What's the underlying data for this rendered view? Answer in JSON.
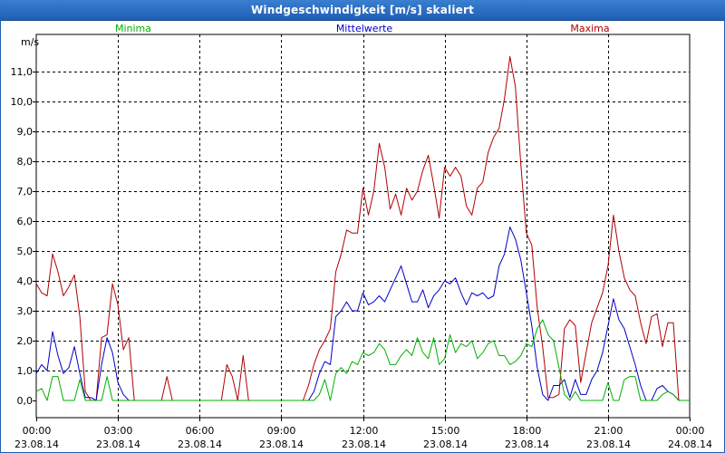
{
  "window": {
    "title": "Windgeschwindigkeit [m/s] skaliert"
  },
  "chart_data": {
    "type": "line",
    "title": "Windgeschwindigkeit [m/s] skaliert",
    "ylabel": "m/s",
    "xlabel": "",
    "ylim": [
      0,
      12
    ],
    "xlim_hours": [
      0,
      24
    ],
    "grid": true,
    "legend_placement": "top",
    "y_ticks": [
      "0,0",
      "1,0",
      "2,0",
      "3,0",
      "4,0",
      "5,0",
      "6,0",
      "7,0",
      "8,0",
      "9,0",
      "10,0",
      "11,0"
    ],
    "x_ticks": [
      {
        "hour": 0,
        "time": "00:00",
        "date": "23.08.14"
      },
      {
        "hour": 3,
        "time": "03:00",
        "date": "23.08.14"
      },
      {
        "hour": 6,
        "time": "06:00",
        "date": "23.08.14"
      },
      {
        "hour": 9,
        "time": "09:00",
        "date": "23.08.14"
      },
      {
        "hour": 12,
        "time": "12:00",
        "date": "23.08.14"
      },
      {
        "hour": 15,
        "time": "15:00",
        "date": "23.08.14"
      },
      {
        "hour": 18,
        "time": "18:00",
        "date": "23.08.14"
      },
      {
        "hour": 21,
        "time": "21:00",
        "date": "23.08.14"
      },
      {
        "hour": 24,
        "time": "00:00",
        "date": "24.08.14"
      }
    ],
    "series": [
      {
        "name": "Minima",
        "color": "#00b000",
        "points": [
          [
            0,
            0.3
          ],
          [
            0.2,
            0.4
          ],
          [
            0.4,
            0.0
          ],
          [
            0.6,
            0.8
          ],
          [
            0.8,
            0.8
          ],
          [
            1.0,
            0.0
          ],
          [
            1.2,
            0.0
          ],
          [
            1.4,
            0.0
          ],
          [
            1.6,
            0.7
          ],
          [
            1.8,
            0.0
          ],
          [
            2.0,
            0.0
          ],
          [
            2.2,
            0.0
          ],
          [
            2.4,
            0.0
          ],
          [
            2.6,
            0.8
          ],
          [
            2.8,
            0.0
          ],
          [
            3.0,
            0.0
          ],
          [
            10.0,
            0.0
          ],
          [
            10.2,
            0.0
          ],
          [
            10.4,
            0.2
          ],
          [
            10.6,
            0.7
          ],
          [
            10.8,
            0.0
          ],
          [
            11.0,
            0.9
          ],
          [
            11.2,
            1.1
          ],
          [
            11.4,
            0.9
          ],
          [
            11.6,
            1.3
          ],
          [
            11.8,
            1.2
          ],
          [
            12.0,
            1.6
          ],
          [
            12.2,
            1.5
          ],
          [
            12.4,
            1.6
          ],
          [
            12.6,
            1.9
          ],
          [
            12.8,
            1.7
          ],
          [
            13.0,
            1.2
          ],
          [
            13.2,
            1.2
          ],
          [
            13.4,
            1.5
          ],
          [
            13.6,
            1.7
          ],
          [
            13.8,
            1.5
          ],
          [
            14.0,
            2.1
          ],
          [
            14.2,
            1.6
          ],
          [
            14.4,
            1.4
          ],
          [
            14.6,
            2.1
          ],
          [
            14.8,
            1.2
          ],
          [
            15.0,
            1.4
          ],
          [
            15.2,
            2.2
          ],
          [
            15.4,
            1.6
          ],
          [
            15.6,
            1.9
          ],
          [
            15.8,
            1.8
          ],
          [
            16.0,
            2.0
          ],
          [
            16.2,
            1.4
          ],
          [
            16.4,
            1.6
          ],
          [
            16.6,
            1.9
          ],
          [
            16.8,
            2.0
          ],
          [
            17.0,
            1.5
          ],
          [
            17.2,
            1.5
          ],
          [
            17.4,
            1.2
          ],
          [
            17.6,
            1.3
          ],
          [
            17.8,
            1.5
          ],
          [
            18.0,
            1.9
          ],
          [
            18.2,
            1.8
          ],
          [
            18.4,
            2.4
          ],
          [
            18.6,
            2.7
          ],
          [
            18.8,
            2.2
          ],
          [
            19.0,
            2.0
          ],
          [
            19.2,
            1.1
          ],
          [
            19.4,
            0.2
          ],
          [
            19.6,
            0.0
          ],
          [
            19.8,
            0.3
          ],
          [
            20.0,
            0.0
          ],
          [
            20.2,
            0.0
          ],
          [
            20.4,
            0.0
          ],
          [
            20.6,
            0.0
          ],
          [
            20.8,
            0.0
          ],
          [
            21.0,
            0.6
          ],
          [
            21.2,
            0.0
          ],
          [
            21.4,
            0.0
          ],
          [
            21.6,
            0.7
          ],
          [
            21.8,
            0.8
          ],
          [
            22.0,
            0.8
          ],
          [
            22.2,
            0.0
          ],
          [
            22.4,
            0.0
          ],
          [
            22.6,
            0.0
          ],
          [
            22.8,
            0.0
          ],
          [
            23.0,
            0.2
          ],
          [
            23.2,
            0.3
          ],
          [
            23.4,
            0.2
          ],
          [
            23.6,
            0.0
          ],
          [
            23.8,
            0.0
          ],
          [
            24.0,
            0.0
          ]
        ]
      },
      {
        "name": "Mittelwerte",
        "color": "#0000c8",
        "points": [
          [
            0,
            0.9
          ],
          [
            0.2,
            1.2
          ],
          [
            0.4,
            1.0
          ],
          [
            0.6,
            2.3
          ],
          [
            0.8,
            1.5
          ],
          [
            1.0,
            0.9
          ],
          [
            1.2,
            1.1
          ],
          [
            1.4,
            1.8
          ],
          [
            1.6,
            0.9
          ],
          [
            1.8,
            0.1
          ],
          [
            2.0,
            0.1
          ],
          [
            2.2,
            0.0
          ],
          [
            2.4,
            1.2
          ],
          [
            2.6,
            2.1
          ],
          [
            2.8,
            1.6
          ],
          [
            3.0,
            0.6
          ],
          [
            3.2,
            0.2
          ],
          [
            3.4,
            0.0
          ],
          [
            10.0,
            0.0
          ],
          [
            10.2,
            0.3
          ],
          [
            10.4,
            0.9
          ],
          [
            10.6,
            1.3
          ],
          [
            10.8,
            1.2
          ],
          [
            11.0,
            2.8
          ],
          [
            11.2,
            3.0
          ],
          [
            11.4,
            3.3
          ],
          [
            11.6,
            3.0
          ],
          [
            11.8,
            3.0
          ],
          [
            12.0,
            3.6
          ],
          [
            12.2,
            3.2
          ],
          [
            12.4,
            3.3
          ],
          [
            12.6,
            3.5
          ],
          [
            12.8,
            3.3
          ],
          [
            13.0,
            3.7
          ],
          [
            13.2,
            4.1
          ],
          [
            13.4,
            4.5
          ],
          [
            13.6,
            3.9
          ],
          [
            13.8,
            3.3
          ],
          [
            14.0,
            3.3
          ],
          [
            14.2,
            3.7
          ],
          [
            14.4,
            3.1
          ],
          [
            14.6,
            3.5
          ],
          [
            14.8,
            3.7
          ],
          [
            15.0,
            4.0
          ],
          [
            15.2,
            3.9
          ],
          [
            15.4,
            4.1
          ],
          [
            15.6,
            3.6
          ],
          [
            15.8,
            3.2
          ],
          [
            16.0,
            3.6
          ],
          [
            16.2,
            3.5
          ],
          [
            16.4,
            3.6
          ],
          [
            16.6,
            3.4
          ],
          [
            16.8,
            3.5
          ],
          [
            17.0,
            4.5
          ],
          [
            17.2,
            4.9
          ],
          [
            17.4,
            5.8
          ],
          [
            17.6,
            5.4
          ],
          [
            17.8,
            4.7
          ],
          [
            18.0,
            3.6
          ],
          [
            18.2,
            2.5
          ],
          [
            18.4,
            1.1
          ],
          [
            18.6,
            0.2
          ],
          [
            18.8,
            0.0
          ],
          [
            19.0,
            0.5
          ],
          [
            19.2,
            0.5
          ],
          [
            19.4,
            0.7
          ],
          [
            19.6,
            0.1
          ],
          [
            19.8,
            0.7
          ],
          [
            20.0,
            0.2
          ],
          [
            20.2,
            0.2
          ],
          [
            20.4,
            0.7
          ],
          [
            20.6,
            1.0
          ],
          [
            20.8,
            1.6
          ],
          [
            21.0,
            2.5
          ],
          [
            21.2,
            3.4
          ],
          [
            21.4,
            2.7
          ],
          [
            21.6,
            2.4
          ],
          [
            21.8,
            1.8
          ],
          [
            22.0,
            1.2
          ],
          [
            22.2,
            0.5
          ],
          [
            22.4,
            0.0
          ],
          [
            22.6,
            0.0
          ],
          [
            22.8,
            0.4
          ],
          [
            23.0,
            0.5
          ],
          [
            23.2,
            0.3
          ],
          [
            23.4,
            0.2
          ],
          [
            23.6,
            0.0
          ],
          [
            24.0,
            0.0
          ]
        ]
      },
      {
        "name": "Maxima",
        "color": "#b00000",
        "points": [
          [
            0,
            3.9
          ],
          [
            0.2,
            3.6
          ],
          [
            0.4,
            3.5
          ],
          [
            0.6,
            4.9
          ],
          [
            0.8,
            4.3
          ],
          [
            1.0,
            3.5
          ],
          [
            1.2,
            3.8
          ],
          [
            1.4,
            4.2
          ],
          [
            1.6,
            2.8
          ],
          [
            1.8,
            0.3
          ],
          [
            2.0,
            0.0
          ],
          [
            2.2,
            0.0
          ],
          [
            2.4,
            2.1
          ],
          [
            2.6,
            2.2
          ],
          [
            2.8,
            3.9
          ],
          [
            3.0,
            3.2
          ],
          [
            3.2,
            1.7
          ],
          [
            3.4,
            2.1
          ],
          [
            3.6,
            0.0
          ],
          [
            4.6,
            0.0
          ],
          [
            4.8,
            0.8
          ],
          [
            5.0,
            0.0
          ],
          [
            5.6,
            0.0
          ],
          [
            6.0,
            0.0
          ],
          [
            6.6,
            0.0
          ],
          [
            6.8,
            0.0
          ],
          [
            7.0,
            1.2
          ],
          [
            7.2,
            0.8
          ],
          [
            7.4,
            0.0
          ],
          [
            7.6,
            1.5
          ],
          [
            7.8,
            0.0
          ],
          [
            9.0,
            0.0
          ],
          [
            9.8,
            0.0
          ],
          [
            10.0,
            0.5
          ],
          [
            10.2,
            1.2
          ],
          [
            10.4,
            1.7
          ],
          [
            10.6,
            2.0
          ],
          [
            10.8,
            2.4
          ],
          [
            11.0,
            4.3
          ],
          [
            11.2,
            4.9
          ],
          [
            11.4,
            5.7
          ],
          [
            11.6,
            5.6
          ],
          [
            11.8,
            5.6
          ],
          [
            12.0,
            7.1
          ],
          [
            12.2,
            6.2
          ],
          [
            12.4,
            7.0
          ],
          [
            12.6,
            8.6
          ],
          [
            12.8,
            7.8
          ],
          [
            13.0,
            6.4
          ],
          [
            13.2,
            6.9
          ],
          [
            13.4,
            6.2
          ],
          [
            13.6,
            7.1
          ],
          [
            13.8,
            6.7
          ],
          [
            14.0,
            7.0
          ],
          [
            14.2,
            7.7
          ],
          [
            14.4,
            8.2
          ],
          [
            14.6,
            7.2
          ],
          [
            14.8,
            6.1
          ],
          [
            15.0,
            7.8
          ],
          [
            15.2,
            7.5
          ],
          [
            15.4,
            7.8
          ],
          [
            15.6,
            7.5
          ],
          [
            15.8,
            6.5
          ],
          [
            16.0,
            6.2
          ],
          [
            16.2,
            7.1
          ],
          [
            16.4,
            7.3
          ],
          [
            16.6,
            8.3
          ],
          [
            16.8,
            8.8
          ],
          [
            17.0,
            9.1
          ],
          [
            17.2,
            10.1
          ],
          [
            17.4,
            11.5
          ],
          [
            17.6,
            10.5
          ],
          [
            17.8,
            7.9
          ],
          [
            18.0,
            5.6
          ],
          [
            18.2,
            5.2
          ],
          [
            18.4,
            3.1
          ],
          [
            18.6,
            1.8
          ],
          [
            18.8,
            0.1
          ],
          [
            19.0,
            0.1
          ],
          [
            19.2,
            0.2
          ],
          [
            19.4,
            2.4
          ],
          [
            19.6,
            2.7
          ],
          [
            19.8,
            2.5
          ],
          [
            20.0,
            0.6
          ],
          [
            20.2,
            1.6
          ],
          [
            20.4,
            2.6
          ],
          [
            20.6,
            3.1
          ],
          [
            20.8,
            3.6
          ],
          [
            21.0,
            4.5
          ],
          [
            21.2,
            6.2
          ],
          [
            21.4,
            5.0
          ],
          [
            21.6,
            4.1
          ],
          [
            21.8,
            3.7
          ],
          [
            22.0,
            3.5
          ],
          [
            22.2,
            2.6
          ],
          [
            22.4,
            1.9
          ],
          [
            22.6,
            2.8
          ],
          [
            22.8,
            2.9
          ],
          [
            23.0,
            1.8
          ],
          [
            23.2,
            2.6
          ],
          [
            23.4,
            2.6
          ],
          [
            23.6,
            0.0
          ],
          [
            24.0,
            0.0
          ]
        ]
      }
    ]
  }
}
